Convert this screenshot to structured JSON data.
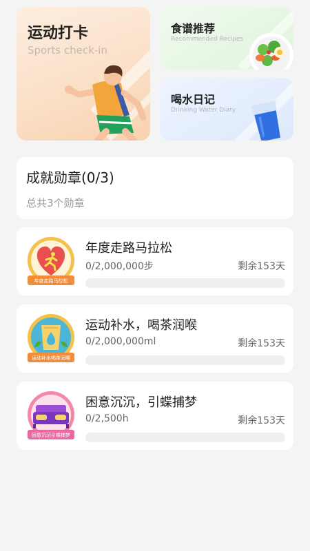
{
  "cards": {
    "sports": {
      "title": "运动打卡",
      "subtitle": "Sports check-in"
    },
    "recipe": {
      "title": "食谱推荐",
      "subtitle": "Recommended Recipes"
    },
    "water": {
      "title": "喝水日记",
      "subtitle": "Drinking Water Diary"
    }
  },
  "summary": {
    "title": "成就勋章(0/3)",
    "subtitle": "总共3个勋章"
  },
  "badges": [
    {
      "name": "年度走路马拉松",
      "progress": "0/2,000,000步",
      "remaining": "剩余153天",
      "ribbon_text": "年度走路马拉松",
      "icon": "running-person-heart-icon",
      "progress_fraction": 0,
      "colors": {
        "main": "#e94f4f",
        "ring": "#f3c24a",
        "ribbon": "#f08c3a"
      }
    },
    {
      "name": "运动补水，喝茶润喉",
      "progress": "0/2,000,000ml",
      "remaining": "剩余153天",
      "ribbon_text": "运动补水喝茶润喉",
      "icon": "water-cup-icon",
      "progress_fraction": 0,
      "colors": {
        "main": "#4cb6d8",
        "ring": "#f3c24a",
        "ribbon": "#f08c3a"
      }
    },
    {
      "name": "困意沉沉，引蝶捕梦",
      "progress": "0/2,500h",
      "remaining": "剩余153天",
      "ribbon_text": "困意沉沉引蝶捕梦",
      "icon": "bed-icon",
      "progress_fraction": 0,
      "colors": {
        "main": "#9a4fd6",
        "ring": "#f08aa8",
        "ribbon": "#e86aa0"
      }
    }
  ]
}
